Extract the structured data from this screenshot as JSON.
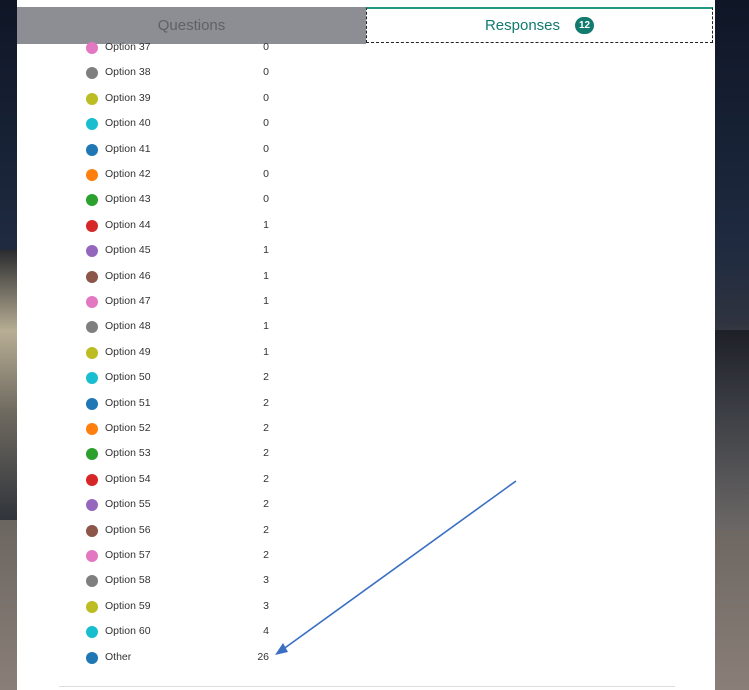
{
  "tabs": {
    "questions_label": "Questions",
    "responses_label": "Responses",
    "responses_count": "12"
  },
  "options": [
    {
      "label": "Option 37",
      "count": "0",
      "color": "#e377c2"
    },
    {
      "label": "Option 38",
      "count": "0",
      "color": "#7f7f7f"
    },
    {
      "label": "Option 39",
      "count": "0",
      "color": "#bcbd22"
    },
    {
      "label": "Option 40",
      "count": "0",
      "color": "#17becf"
    },
    {
      "label": "Option 41",
      "count": "0",
      "color": "#1f77b4"
    },
    {
      "label": "Option 42",
      "count": "0",
      "color": "#ff7f0e"
    },
    {
      "label": "Option 43",
      "count": "0",
      "color": "#2ca02c"
    },
    {
      "label": "Option 44",
      "count": "1",
      "color": "#d62728"
    },
    {
      "label": "Option 45",
      "count": "1",
      "color": "#9467bd"
    },
    {
      "label": "Option 46",
      "count": "1",
      "color": "#8c564b"
    },
    {
      "label": "Option 47",
      "count": "1",
      "color": "#e377c2"
    },
    {
      "label": "Option 48",
      "count": "1",
      "color": "#7f7f7f"
    },
    {
      "label": "Option 49",
      "count": "1",
      "color": "#bcbd22"
    },
    {
      "label": "Option 50",
      "count": "2",
      "color": "#17becf"
    },
    {
      "label": "Option 51",
      "count": "2",
      "color": "#1f77b4"
    },
    {
      "label": "Option 52",
      "count": "2",
      "color": "#ff7f0e"
    },
    {
      "label": "Option 53",
      "count": "2",
      "color": "#2ca02c"
    },
    {
      "label": "Option 54",
      "count": "2",
      "color": "#d62728"
    },
    {
      "label": "Option 55",
      "count": "2",
      "color": "#9467bd"
    },
    {
      "label": "Option 56",
      "count": "2",
      "color": "#8c564b"
    },
    {
      "label": "Option 57",
      "count": "2",
      "color": "#e377c2"
    },
    {
      "label": "Option 58",
      "count": "3",
      "color": "#7f7f7f"
    },
    {
      "label": "Option 59",
      "count": "3",
      "color": "#bcbd22"
    },
    {
      "label": "Option 60",
      "count": "4",
      "color": "#17becf"
    },
    {
      "label": "Other",
      "count": "26",
      "color": "#1f77b4"
    }
  ],
  "colors": {
    "accent": "#127a6e",
    "arrow": "#3a6fc4"
  }
}
